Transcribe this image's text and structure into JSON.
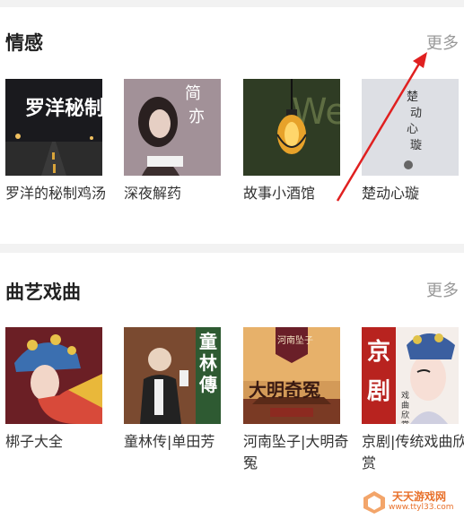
{
  "sections": [
    {
      "title": "情感",
      "more_label": "更多",
      "items": [
        {
          "caption": "罗洋的秘制鸡汤",
          "cover_text": "罗洋秘制"
        },
        {
          "caption": "深夜解药",
          "cover_text": "简亦"
        },
        {
          "caption": "故事小酒馆",
          "cover_text": ""
        },
        {
          "caption": "楚动心璇",
          "cover_text": "楚动心璇"
        }
      ]
    },
    {
      "title": "曲艺戏曲",
      "more_label": "更多",
      "items": [
        {
          "caption": "梆子大全",
          "cover_text": ""
        },
        {
          "caption": "童林传|单田芳",
          "cover_text": "童林傳"
        },
        {
          "caption": "河南坠子|大明奇冤",
          "cover_text": "大明奇冤",
          "cover_subtext": "河南坠子"
        },
        {
          "caption": "京剧|传统戏曲欣赏",
          "cover_text": "京剧",
          "cover_subtext": "戏曲欣赏"
        }
      ]
    }
  ],
  "watermark": {
    "line1": "天天游戏网",
    "line2": "www.ttyl33.com"
  },
  "colors": {
    "arrow": "#e02020",
    "accent": "#e8702a"
  }
}
